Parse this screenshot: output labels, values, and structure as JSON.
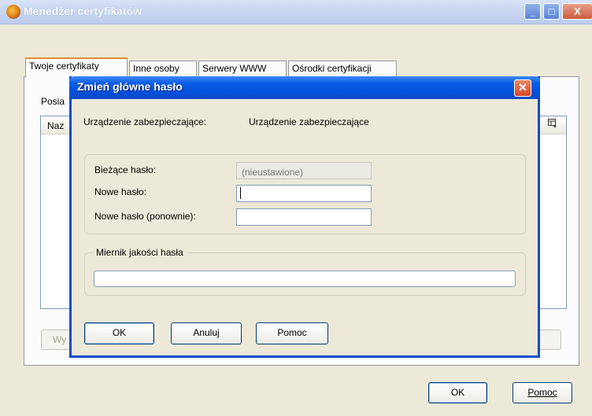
{
  "window": {
    "title": "Menedżer certyfikatów",
    "controls": {
      "minimize": "_",
      "maximize": "□",
      "close": "X"
    },
    "tabs": [
      {
        "label": "Twoje certyfikaty",
        "active": true
      },
      {
        "label": "Inne osoby",
        "active": false
      },
      {
        "label": "Serwery WWW",
        "active": false
      },
      {
        "label": "Ośrodki certyfikacji",
        "active": false
      }
    ],
    "panel_text": "Posia",
    "table_header_text": "Naz",
    "column_picker_icon": "column-picker-icon",
    "left_button_partial": "Wy",
    "ok_label": "OK",
    "help_label": "Pomoc"
  },
  "dialog": {
    "title": "Zmień główne hasło",
    "close_glyph": "✕",
    "device_label": "Urządzenie zabezpieczające:",
    "device_value": "Urządzenie zabezpieczające",
    "current_password_label": "Bieżące hasło:",
    "current_password_placeholder": "(nieustawione)",
    "new_password_label": "Nowe hasło:",
    "new_password_value": "",
    "repeat_password_label": "Nowe hasło (ponownie):",
    "repeat_password_value": "",
    "quality_meter_label": "Miernik jakości hasła",
    "quality_meter_level": 0,
    "ok_label": "OK",
    "cancel_label": "Anuluj",
    "help_label": "Pomoc"
  },
  "colors": {
    "dialog_title_bar": "#0250dc",
    "outer_title_bar": "#c9d8f2",
    "window_face": "#ece9d8",
    "close_button": "#d5462a"
  }
}
